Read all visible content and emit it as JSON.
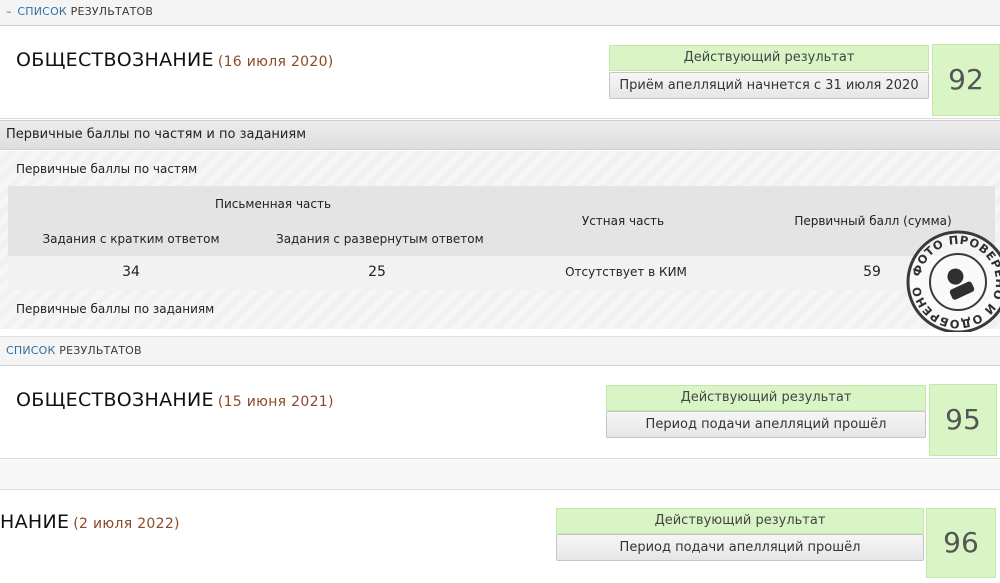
{
  "list_header": {
    "dash": "–",
    "link_label": "СПИСОК",
    "label": "РЕЗУЛЬТАТОВ"
  },
  "results": [
    {
      "subject": "ОБЩЕСТВОЗНАНИЕ",
      "date": "(16 июля 2020)",
      "status": "Действующий результат",
      "appeal": "Приём апелляций начнется с 31 июля 2020",
      "score": "92"
    },
    {
      "subject": "ОБЩЕСТВОЗНАНИЕ",
      "date": "(15 июня 2021)",
      "status": "Действующий результат",
      "appeal": "Период подачи апелляций прошёл",
      "score": "95"
    },
    {
      "subject": "НАНИЕ",
      "date": "(2 июля 2022)",
      "status": "Действующий результат",
      "appeal": "Период подачи апелляций прошёл",
      "score": "96"
    }
  ],
  "details": {
    "bar_title": "Первичные баллы по частям и по заданиям",
    "by_parts_label": "Первичные баллы по частям",
    "by_tasks_label": "Первичные баллы по заданиям",
    "headers": {
      "written": "Письменная часть",
      "short": "Задания с кратким ответом",
      "extended": "Задания с развернутым ответом",
      "oral": "Устная часть",
      "primary_sum": "Первичный балл (сумма)"
    },
    "values": {
      "short": "34",
      "extended": "25",
      "oral": "Отсутствует в КИМ",
      "primary_sum": "59"
    }
  },
  "stamp": {
    "text": "ФОТО ПРОВЕРЕНО И ОДОБРЕНО"
  },
  "colors": {
    "status_green": "#d9f5c5",
    "date_brown": "#8a4a28",
    "link_blue": "#2f6fa3"
  }
}
